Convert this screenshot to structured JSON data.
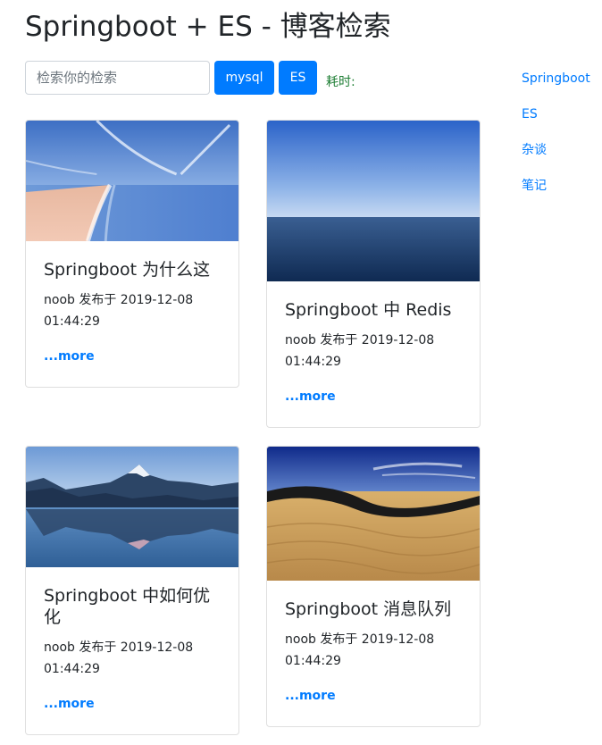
{
  "header": {
    "title": "Springboot + ES - 博客检索"
  },
  "search": {
    "placeholder": "检索你的检索",
    "value": "",
    "mysql_label": "mysql",
    "es_label": "ES",
    "elapsed_label": "耗时:"
  },
  "sidebar": {
    "items": [
      {
        "label": "Springboot"
      },
      {
        "label": "ES"
      },
      {
        "label": "杂谈"
      },
      {
        "label": "笔记"
      }
    ]
  },
  "cards": [
    {
      "title": "Springboot 为什么这",
      "meta": "noob 发布于 2019-12-08 01:44:29",
      "more": "...more",
      "image": "beach-photo"
    },
    {
      "title": "Springboot 中 Redis",
      "meta": "noob 发布于 2019-12-08 01:44:29",
      "more": "...more",
      "image": "ocean-horizon-photo"
    },
    {
      "title": "Springboot 中如何优化",
      "meta": "noob 发布于 2019-12-08 01:44:29",
      "more": "...more",
      "image": "mountain-lake-photo"
    },
    {
      "title": "Springboot 消息队列",
      "meta": "noob 发布于 2019-12-08 01:44:29",
      "more": "...more",
      "image": "desert-dunes-photo"
    }
  ],
  "colors": {
    "accent": "#007bff",
    "elapsed": "#1e7e34",
    "text": "#212529",
    "border": "#dfdfdf"
  }
}
